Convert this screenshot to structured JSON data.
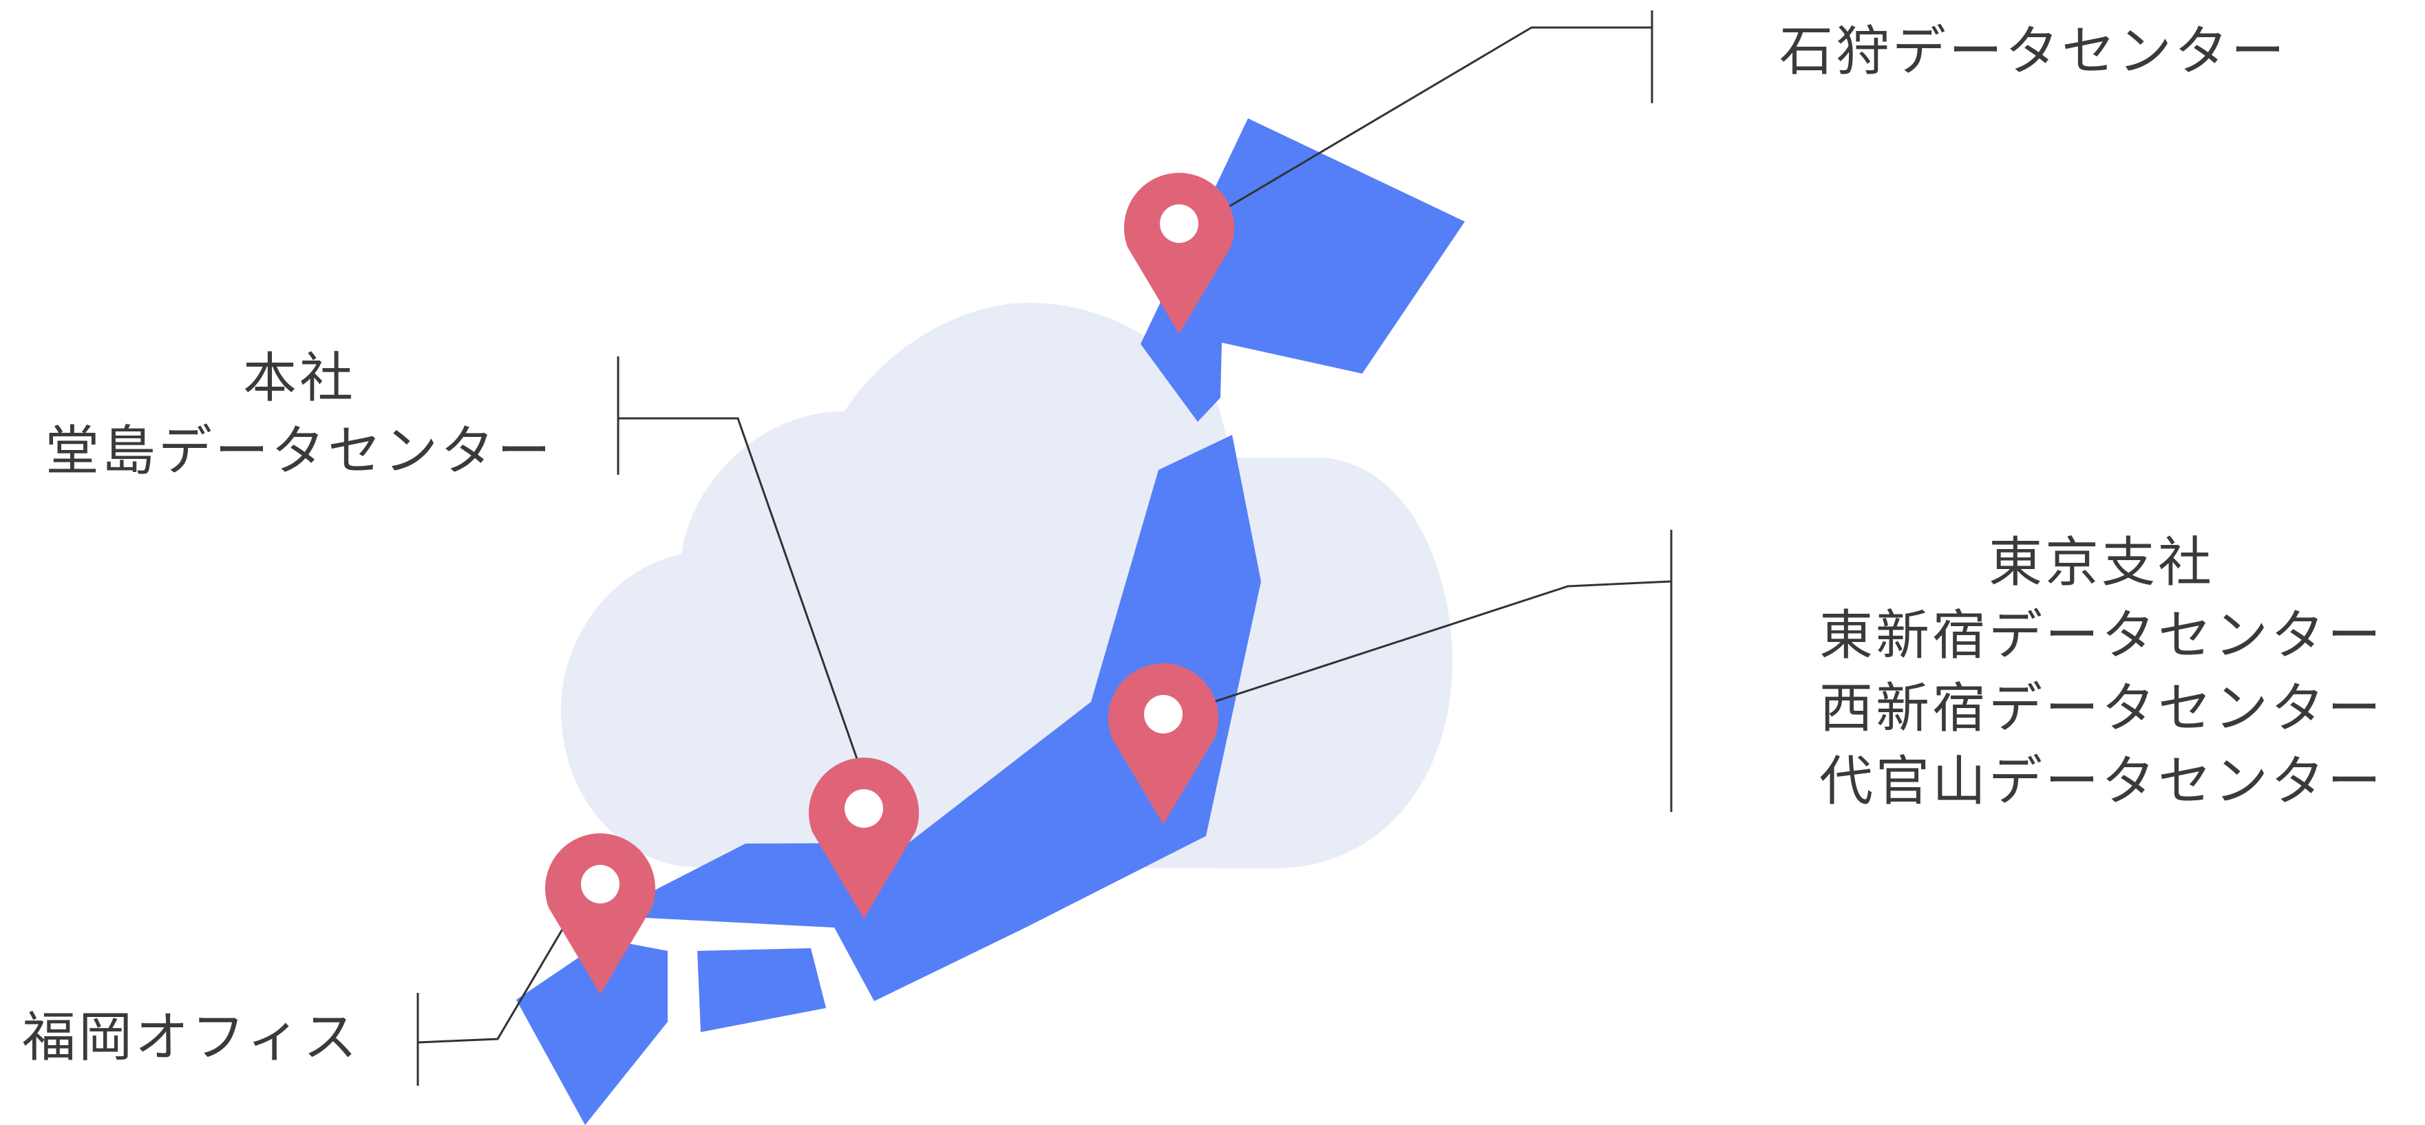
{
  "colors": {
    "cloud": "#e7ecf7",
    "land": "#557ff7",
    "pin": "#e06477",
    "pin_hole": "#ffffff",
    "leader_line": "#333333",
    "text": "#3a3a3a"
  },
  "locations": {
    "ishikari": {
      "lines": [
        "石狩データセンター"
      ],
      "icon": "map-pin-icon"
    },
    "osaka": {
      "lines": [
        "本社",
        "堂島データセンター"
      ],
      "icon": "map-pin-icon"
    },
    "tokyo": {
      "lines": [
        "東京支社",
        "東新宿データセンター",
        "西新宿データセンター",
        "代官山データセンター"
      ],
      "icon": "map-pin-icon"
    },
    "fukuoka": {
      "lines": [
        "福岡オフィス"
      ],
      "icon": "map-pin-icon"
    }
  }
}
